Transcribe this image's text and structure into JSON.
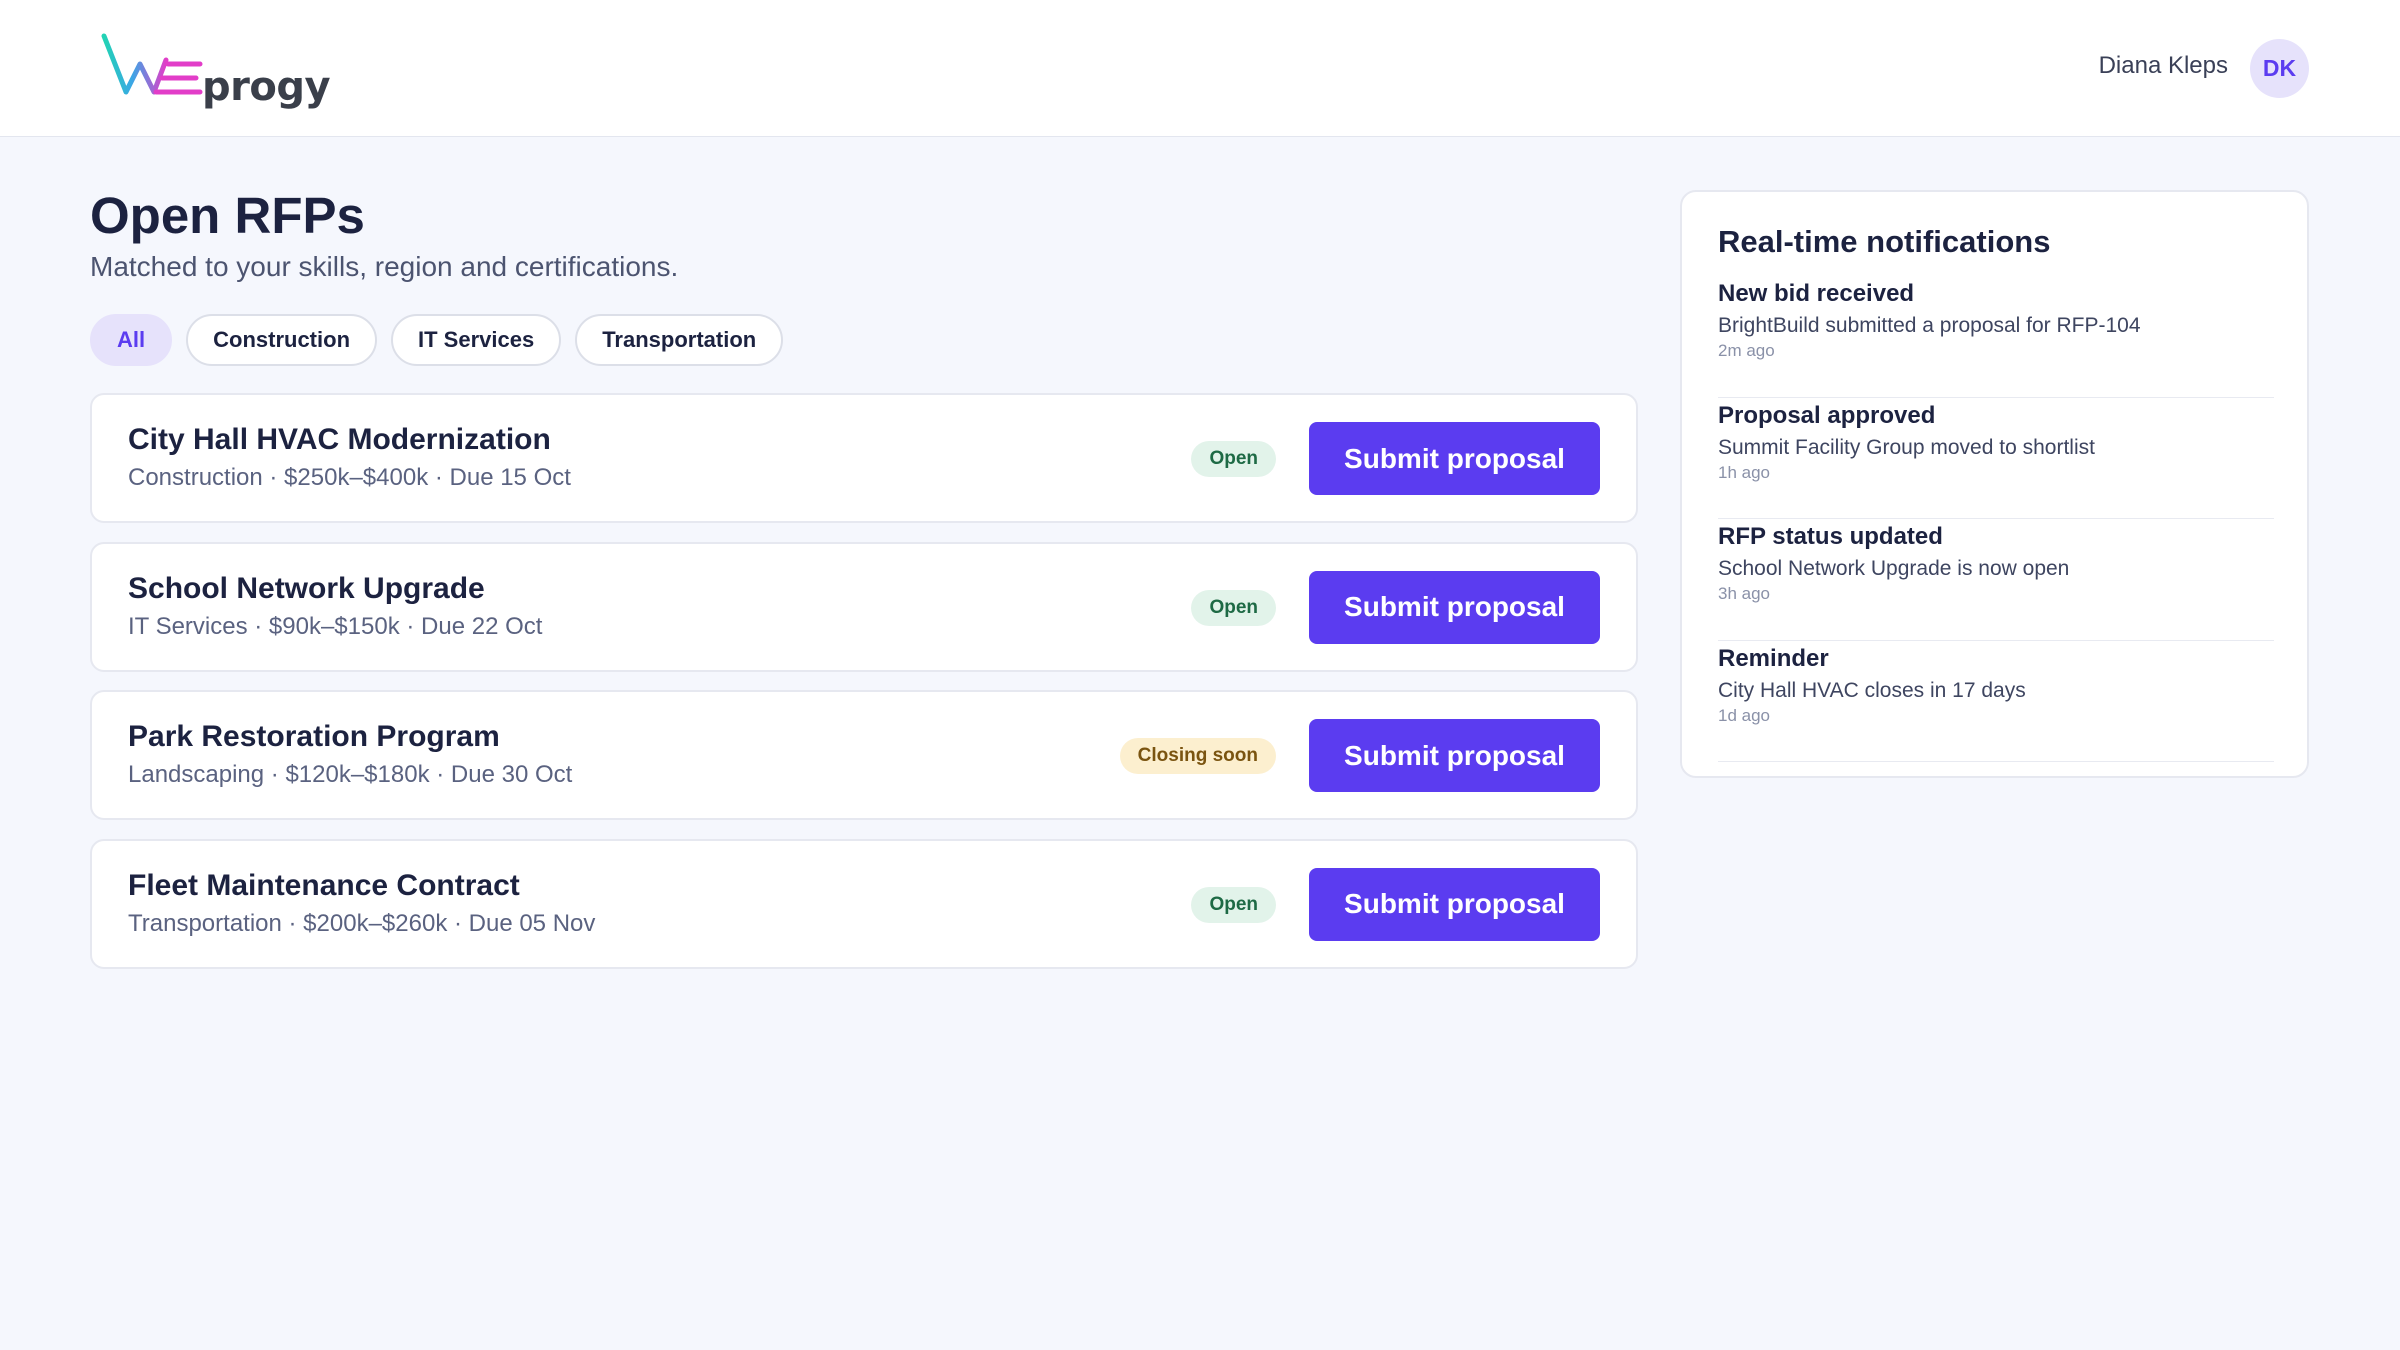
{
  "header": {
    "logo_text": "progy",
    "user_name": "Diana Kleps",
    "avatar_initials": "DK"
  },
  "page": {
    "title": "Open RFPs",
    "subtitle": "Matched to your skills, region and certifications."
  },
  "filters": [
    {
      "label": "All",
      "active": true
    },
    {
      "label": "Construction",
      "active": false
    },
    {
      "label": "IT Services",
      "active": false
    },
    {
      "label": "Transportation",
      "active": false
    }
  ],
  "rfps": [
    {
      "title": "City Hall HVAC Modernization",
      "meta": "Construction · $250k–$400k · Due 15 Oct",
      "status": "Open",
      "status_type": "open",
      "action_label": "Submit proposal"
    },
    {
      "title": "School Network Upgrade",
      "meta": "IT Services · $90k–$150k · Due 22 Oct",
      "status": "Open",
      "status_type": "open",
      "action_label": "Submit proposal"
    },
    {
      "title": "Park Restoration Program",
      "meta": "Landscaping · $120k–$180k · Due 30 Oct",
      "status": "Closing soon",
      "status_type": "closing",
      "action_label": "Submit proposal"
    },
    {
      "title": "Fleet Maintenance Contract",
      "meta": "Transportation · $200k–$260k · Due 05 Nov",
      "status": "Open",
      "status_type": "open",
      "action_label": "Submit proposal"
    }
  ],
  "notifications": {
    "heading": "Real-time notifications",
    "items": [
      {
        "title": "New bid received",
        "description": "BrightBuild submitted a proposal for RFP-104",
        "time": "2m ago"
      },
      {
        "title": "Proposal approved",
        "description": "Summit Facility Group moved to shortlist",
        "time": "1h ago"
      },
      {
        "title": "RFP status updated",
        "description": "School Network Upgrade is now open",
        "time": "3h ago"
      },
      {
        "title": "Reminder",
        "description": "City Hall HVAC closes in 17 days",
        "time": "1d ago"
      }
    ]
  },
  "colors": {
    "accent": "#5b3cf0",
    "open_badge_bg": "#e2f3ea",
    "closing_badge_bg": "#fcefcf",
    "logo_teal": "#22d3b4",
    "logo_magenta": "#e23dc8"
  }
}
